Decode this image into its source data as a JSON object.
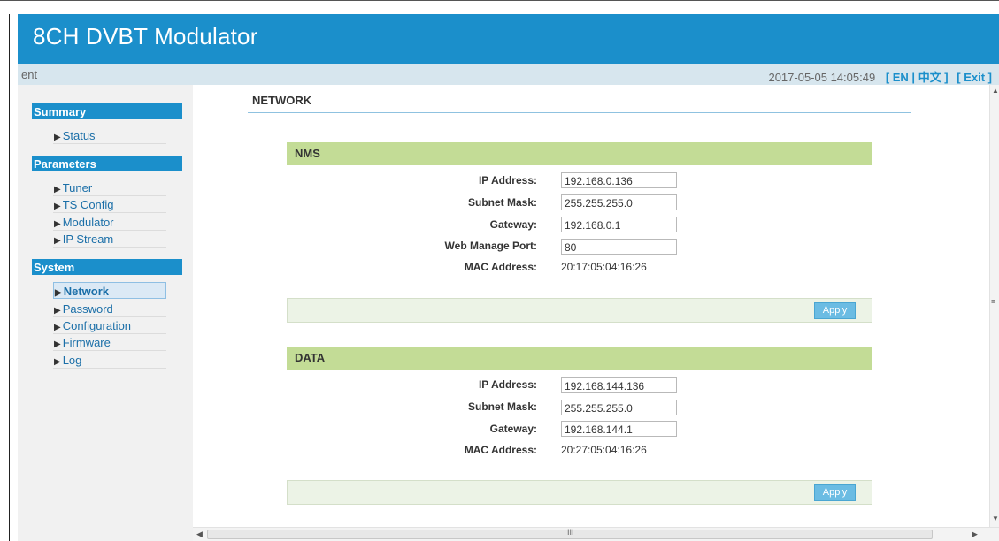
{
  "header": {
    "title": "8CH DVBT Modulator"
  },
  "infobar": {
    "left_text": "ent",
    "datetime": "2017-05-05 14:05:49",
    "lang_en": "[ EN |",
    "lang_cn": "中文 ]",
    "exit": "[ Exit ]"
  },
  "sidebar": {
    "summary": {
      "title": "Summary",
      "items": [
        "Status"
      ]
    },
    "parameters": {
      "title": "Parameters",
      "items": [
        "Tuner",
        "TS Config",
        "Modulator",
        "IP Stream"
      ]
    },
    "system": {
      "title": "System",
      "items": [
        "Network",
        "Password",
        "Configuration",
        "Firmware",
        "Log"
      ],
      "active": "Network"
    }
  },
  "page": {
    "title": "NETWORK"
  },
  "nms": {
    "title": "NMS",
    "labels": {
      "ip": "IP Address:",
      "subnet": "Subnet Mask:",
      "gateway": "Gateway:",
      "port": "Web Manage Port:",
      "mac": "MAC Address:"
    },
    "values": {
      "ip": "192.168.0.136",
      "subnet": "255.255.255.0",
      "gateway": "192.168.0.1",
      "port": "80",
      "mac": "20:17:05:04:16:26"
    },
    "apply": "Apply"
  },
  "data_group": {
    "title": "DATA",
    "labels": {
      "ip": "IP Address:",
      "subnet": "Subnet Mask:",
      "gateway": "Gateway:",
      "mac": "MAC Address:"
    },
    "values": {
      "ip": "192.168.144.136",
      "subnet": "255.255.255.0",
      "gateway": "192.168.144.1",
      "mac": "20:27:05:04:16:26"
    },
    "apply": "Apply"
  },
  "scrollbar": {
    "grip_v": "≡",
    "grip_h": "III"
  },
  "colors": {
    "brand": "#1b8fcb",
    "group_header": "#c3dc96",
    "action_bar": "#ecf3e6",
    "apply_button": "#6bbce3"
  }
}
